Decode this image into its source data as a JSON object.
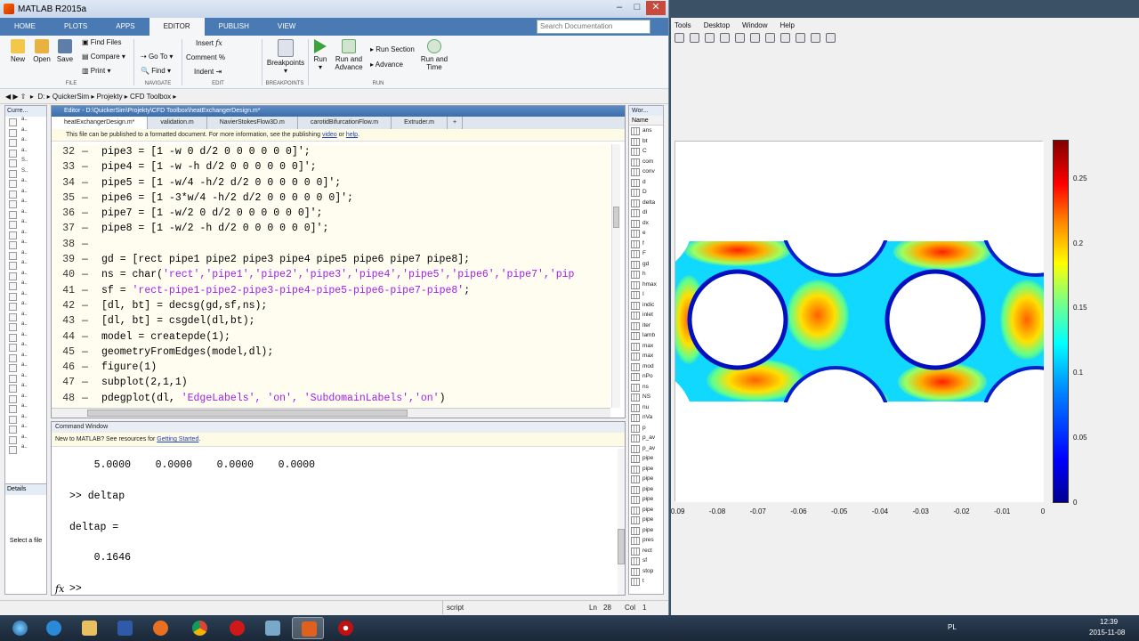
{
  "window": {
    "title": "MATLAB R2015a"
  },
  "ribbon": {
    "tabs": [
      "HOME",
      "PLOTS",
      "APPS",
      "EDITOR",
      "PUBLISH",
      "VIEW"
    ],
    "selected_tab": "EDITOR",
    "search_placeholder": "Search Documentation",
    "buttons": {
      "new": "New",
      "open": "Open",
      "save": "Save",
      "find_files": "Find Files",
      "compare": "Compare",
      "print": "Print",
      "insert": "Insert",
      "go_to": "Go To",
      "comment": "Comment",
      "find": "Find",
      "indent": "Indent",
      "breakpoints": "Breakpoints",
      "run": "Run",
      "run_and_advance": "Run and Advance",
      "run_section": "Run Section",
      "advance": "Advance",
      "run_and_time": "Run and Time"
    },
    "groups": {
      "file": "FILE",
      "navigate": "NAVIGATE",
      "edit": "EDIT",
      "breakpoints": "BREAKPOINTS",
      "run": "RUN"
    }
  },
  "address": {
    "path": [
      "D:",
      "QuickerSim",
      "Projekty",
      "CFD Toolbox"
    ]
  },
  "current_folder": {
    "title": "Curre...",
    "rows": [
      "a..",
      "a..",
      "a..",
      "a..",
      "S..",
      "S..",
      "a..",
      "a..",
      "a..",
      "a..",
      "a..",
      "a..",
      "a..",
      "a..",
      "a..",
      "a..",
      "a..",
      "a..",
      "a..",
      "a..",
      "a..",
      "a..",
      "a..",
      "a..",
      "a..",
      "a..",
      "a..",
      "a..",
      "a..",
      "a..",
      "a..",
      "a..",
      "a.."
    ]
  },
  "details": {
    "title": "Details",
    "empty": "Select a file"
  },
  "editor": {
    "title": "Editor - D:\\QuickerSim\\Projekty\\CFD Toolbox\\heatExchangerDesign.m*",
    "tabs": [
      "heatExchangerDesign.m*",
      "validation.m",
      "NavierStokesFlow3D.m",
      "carotidBifurcationFlow.m",
      "Extruder.m",
      "+"
    ],
    "publish_bar": {
      "text": "This file can be published to a formatted document. For more information, see the publishing",
      "link1": "video",
      "or": "or",
      "link2": "help",
      "end": "."
    },
    "lines": [
      {
        "n": "32",
        "code": "pipe3 = [1 -w 0 d/2 0 0 0 0 0 0]';"
      },
      {
        "n": "33",
        "code": "pipe4 = [1 -w -h d/2 0 0 0 0 0 0]';"
      },
      {
        "n": "34",
        "code": "pipe5 = [1 -w/4 -h/2 d/2 0 0 0 0 0 0]';"
      },
      {
        "n": "35",
        "code": "pipe6 = [1 -3*w/4 -h/2 d/2 0 0 0 0 0 0]';"
      },
      {
        "n": "36",
        "code": "pipe7 = [1 -w/2 0 d/2 0 0 0 0 0 0]';"
      },
      {
        "n": "37",
        "code": "pipe8 = [1 -w/2 -h d/2 0 0 0 0 0 0]';"
      },
      {
        "n": "38",
        "code": ""
      },
      {
        "n": "39",
        "code": "gd = [rect pipe1 pipe2 pipe3 pipe4 pipe5 pipe6 pipe7 pipe8];"
      },
      {
        "n": "40",
        "pre": "ns = char(",
        "str": "'rect','pipe1','pipe2','pipe3','pipe4','pipe5','pipe6','pipe7','pip",
        "post": ""
      },
      {
        "n": "41",
        "pre": "sf = ",
        "str": "'rect-pipe1-pipe2-pipe3-pipe4-pipe5-pipe6-pipe7-pipe8'",
        "post": ";"
      },
      {
        "n": "42",
        "code": "[dl, bt] = decsg(gd,sf,ns);"
      },
      {
        "n": "43",
        "code": "[dl, bt] = csgdel(dl,bt);"
      },
      {
        "n": "44",
        "code": "model = createpde(1);"
      },
      {
        "n": "45",
        "code": "geometryFromEdges(model,dl);"
      },
      {
        "n": "46",
        "code": "figure(1)"
      },
      {
        "n": "47",
        "code": "subplot(2,1,1)"
      },
      {
        "n": "48",
        "pre": "pdegplot(dl, ",
        "str": "'EdgeLabels', 'on', 'SubdomainLabels','on'",
        "post": ")"
      }
    ]
  },
  "command_window": {
    "title": "Command Window",
    "notice": "New to MATLAB? See resources for",
    "notice_link": "Getting Started",
    "notice_end": ".",
    "lines": [
      "    5.0000    0.0000    0.0000    0.0000",
      "",
      ">> deltap",
      "",
      "deltap =",
      "",
      "    0.1646"
    ],
    "prompt": ">>",
    "fx": "fx"
  },
  "workspace": {
    "title": "Wor...",
    "header": "Name",
    "vars": [
      "ans",
      "bt",
      "C",
      "com",
      "conv",
      "d",
      "D",
      "delta",
      "dl",
      "dx",
      "e",
      "f",
      "F",
      "gd",
      "h",
      "hmax",
      "I",
      "indic",
      "inlet",
      "iter",
      "lamb",
      "max",
      "max",
      "mod",
      "nPo",
      "ns",
      "NS",
      "nu",
      "nVa",
      "p",
      "p_av",
      "p_av",
      "pipe",
      "pipe",
      "pipe",
      "pipe",
      "pipe",
      "pipe",
      "pipe",
      "pipe",
      "pres",
      "rect",
      "sf",
      "stop",
      "t"
    ]
  },
  "status_bar": {
    "mode": "script",
    "ln_label": "Ln",
    "ln": "28",
    "col_label": "Col",
    "col": "1"
  },
  "figure": {
    "menu": [
      "Tools",
      "Desktop",
      "Window",
      "Help"
    ],
    "x_ticks": [
      "-0.09",
      "-0.08",
      "-0.07",
      "-0.06",
      "-0.05",
      "-0.04",
      "-0.03",
      "-0.02",
      "-0.01",
      "0"
    ],
    "colorbar_ticks": [
      "0.25",
      "0.2",
      "0.15",
      "0.1",
      "0.05",
      "0"
    ]
  },
  "taskbar": {
    "lang": "PL",
    "time": "12:39",
    "date": "2015-11-08"
  }
}
